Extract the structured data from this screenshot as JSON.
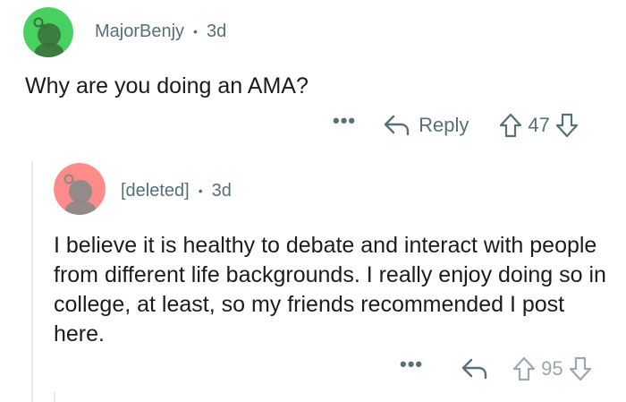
{
  "comment": {
    "username": "MajorBenjy",
    "separator": "•",
    "age": "3d",
    "text": "Why are you doing an AMA?",
    "more_label": "•••",
    "reply_label": "Reply",
    "score": "47",
    "avatar_color": "#46d160"
  },
  "reply": {
    "username": "[deleted]",
    "separator": "•",
    "age": "3d",
    "text": "I believe it is healthy to debate and interact with people from different life backgrounds. I really enjoy doing so in college, at least, so my friends recommended I post here.",
    "more_label": "•••",
    "score": "95",
    "avatar_color": "#ff8b8b"
  },
  "icons": {
    "reply": "reply-arrow-icon",
    "upvote": "upvote-arrow-icon",
    "downvote": "downvote-arrow-icon",
    "more": "more-dots-icon",
    "avatar": "snoo-avatar-icon"
  },
  "colors": {
    "meta": "#576f76",
    "text": "#1c1c1c",
    "thread_line": "#e5ebee"
  }
}
